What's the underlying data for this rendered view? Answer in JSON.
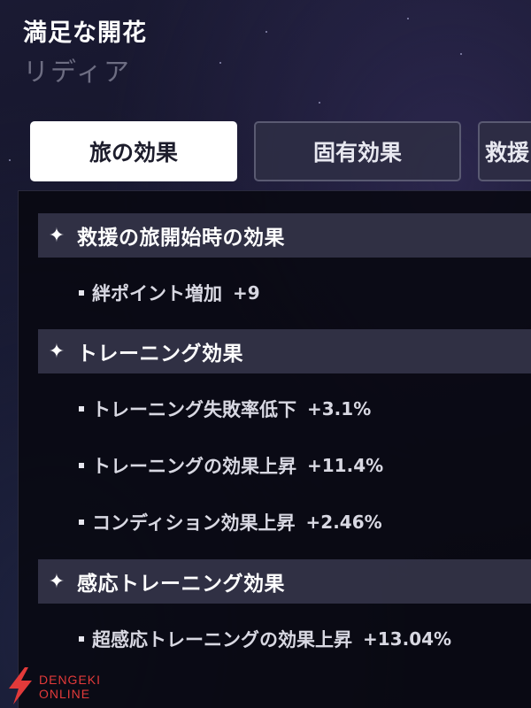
{
  "header": {
    "title": "満足な開花",
    "subtitle": "リディア"
  },
  "tabs": [
    {
      "label": "旅の効果",
      "active": true
    },
    {
      "label": "固有効果",
      "active": false
    },
    {
      "label": "救援",
      "active": false
    }
  ],
  "sections": [
    {
      "icon": "sparkle-icon",
      "glyph": "✦",
      "label": "救援の旅開始時の効果",
      "effects": [
        {
          "name": "絆ポイント増加",
          "value": "+9"
        }
      ]
    },
    {
      "icon": "sparkle-icon",
      "glyph": "✦",
      "label": "トレーニング効果",
      "effects": [
        {
          "name": "トレーニング失敗率低下",
          "value": "+3.1%"
        },
        {
          "name": "トレーニングの効果上昇",
          "value": "+11.4%"
        },
        {
          "name": "コンディション効果上昇",
          "value": "+2.46%"
        }
      ]
    },
    {
      "icon": "sparkle-icon",
      "glyph": "✦",
      "label": "感応トレーニング効果",
      "effects": [
        {
          "name": "超感応トレーニングの効果上昇",
          "value": "+13.04%"
        }
      ]
    }
  ],
  "watermark": {
    "line1": "DENGEKI",
    "line2": "ONLINE",
    "color": "#e23a3a"
  },
  "colors": {
    "active_tab_bg": "#ffffff",
    "inactive_tab_bg": "#2e2e44",
    "section_header_bg": "#37374c",
    "panel_bg": "#090912"
  }
}
